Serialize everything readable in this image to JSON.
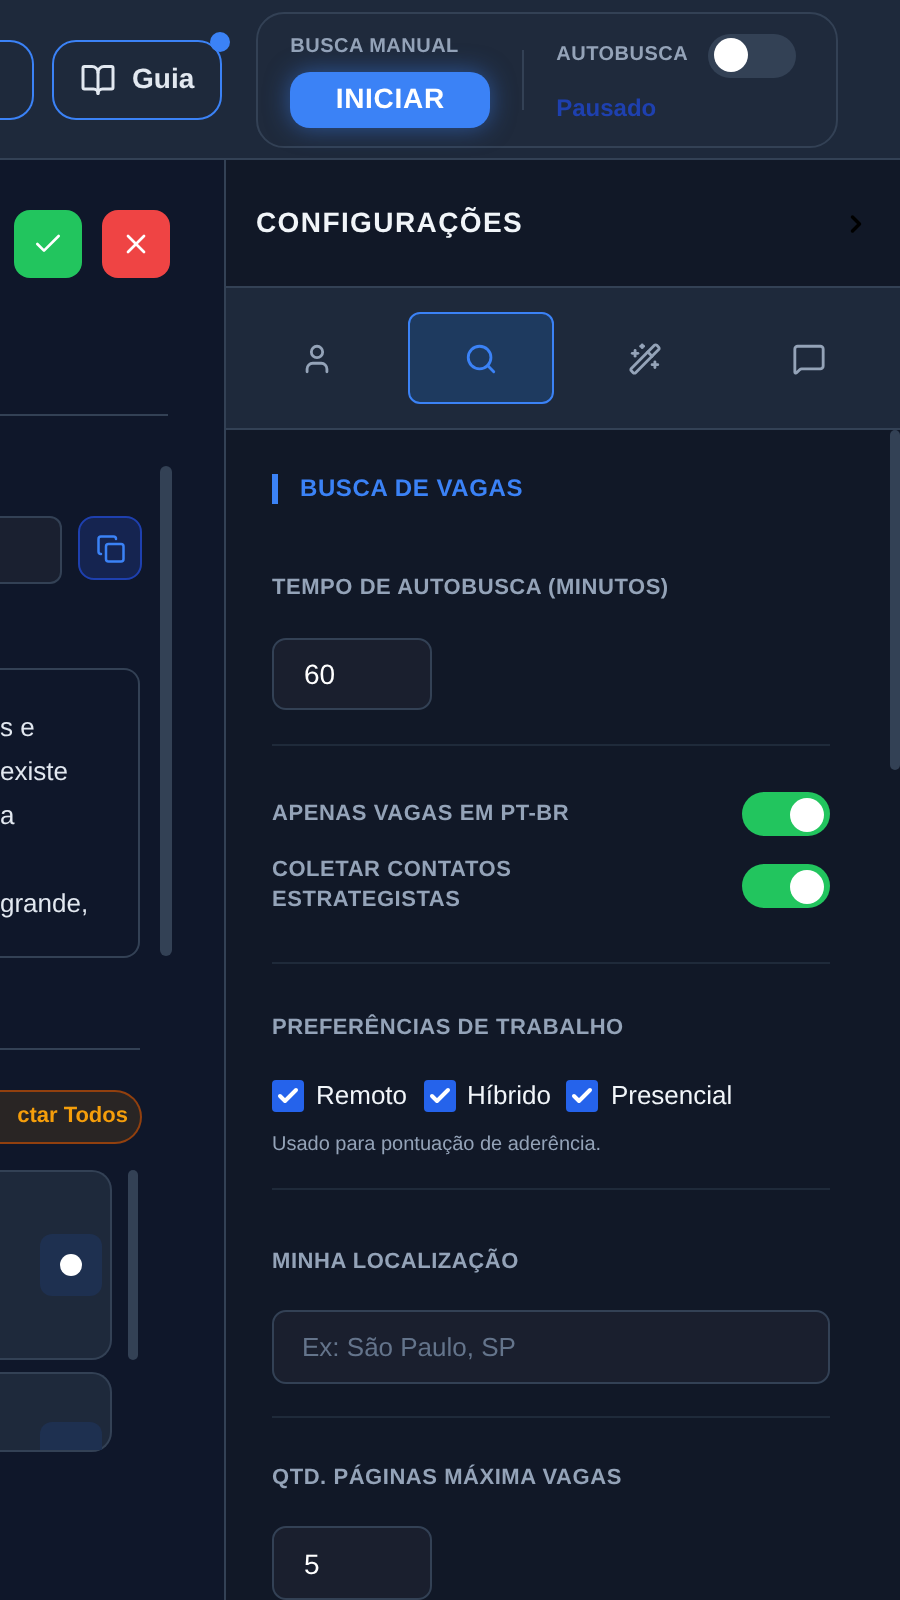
{
  "header": {
    "guide_button": {
      "label": "Guia",
      "dot": true
    },
    "manual_search": {
      "label": "BUSCA MANUAL",
      "button": "INICIAR"
    },
    "autosearch": {
      "label": "AUTOBUSCA",
      "on": false,
      "status": "Pausado"
    }
  },
  "left_pane": {
    "text_lines": [
      "s e",
      "existe",
      "a",
      "grande,"
    ],
    "select_all_button": "ctar Todos"
  },
  "settings": {
    "title": "CONFIGURAÇÕES",
    "tabs": [
      {
        "kind": "profile",
        "selected": false
      },
      {
        "kind": "search",
        "selected": true
      },
      {
        "kind": "magic",
        "selected": false
      },
      {
        "kind": "chat",
        "selected": false
      }
    ],
    "section_title": "BUSCA DE VAGAS",
    "autosearch_interval": {
      "label": "TEMPO DE AUTOBUSCA (MINUTOS)",
      "value": "60"
    },
    "toggles": [
      {
        "label": "APENAS VAGAS EM PT-BR",
        "on": true
      },
      {
        "label": "COLETAR CONTATOS ESTRATEGISTAS",
        "on": true
      }
    ],
    "work_preferences": {
      "label": "PREFERÊNCIAS DE TRABALHO",
      "options": [
        {
          "label": "Remoto",
          "checked": true
        },
        {
          "label": "Híbrido",
          "checked": true
        },
        {
          "label": "Presencial",
          "checked": true
        }
      ],
      "hint": "Usado para pontuação de aderência."
    },
    "location": {
      "label": "MINHA LOCALIZAÇÃO",
      "placeholder": "Ex: São Paulo, SP"
    },
    "max_pages": {
      "label": "QTD. PÁGINAS MÁXIMA VAGAS",
      "value": "5"
    }
  }
}
